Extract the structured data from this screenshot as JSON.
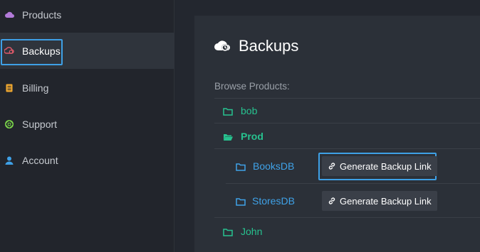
{
  "sidebar": {
    "items": [
      {
        "label": "Products",
        "icon": "cloud-icon",
        "color": "#b27ad8"
      },
      {
        "label": "Backups",
        "icon": "cloud-backup-icon",
        "color": "#e05a6a",
        "active": true
      },
      {
        "label": "Billing",
        "icon": "receipt-icon",
        "color": "#f0a830"
      },
      {
        "label": "Support",
        "icon": "lifebuoy-icon",
        "color": "#7bd64a"
      },
      {
        "label": "Account",
        "icon": "user-icon",
        "color": "#3ea0e6"
      }
    ]
  },
  "main": {
    "title": "Backups",
    "browse_label": "Browse Products:",
    "tree": [
      {
        "name": "bob",
        "type": "product",
        "open": false
      },
      {
        "name": "Prod",
        "type": "product",
        "open": true,
        "children": [
          {
            "name": "BooksDB",
            "button": "Generate Backup Link"
          },
          {
            "name": "StoresDB",
            "button": "Generate Backup Link"
          }
        ]
      },
      {
        "name": "John",
        "type": "product",
        "open": false
      }
    ]
  },
  "colors": {
    "accent": "#3ea0e6",
    "product_green": "#27c28f",
    "db_blue": "#3fa2e8"
  }
}
